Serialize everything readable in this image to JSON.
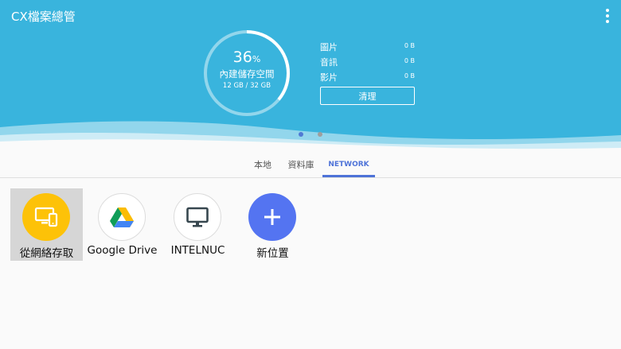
{
  "app": {
    "title": "CX檔案總管"
  },
  "storage": {
    "percent": "36",
    "percent_sign": "%",
    "label": "內建儲存空間",
    "size": "12 GB / 32 GB",
    "used_fraction": 0.36
  },
  "stats": [
    {
      "label": "圖片",
      "value": "0 B"
    },
    {
      "label": "音訊",
      "value": "0 B"
    },
    {
      "label": "影片",
      "value": "0 B"
    }
  ],
  "clean_button": "清理",
  "pager": {
    "pages": 2,
    "active": 1
  },
  "tabs": [
    {
      "label": "本地"
    },
    {
      "label": "資料庫"
    },
    {
      "label": "NETWORK",
      "active": true
    }
  ],
  "items": [
    {
      "label": "從網絡存取",
      "icon": "network-devices-icon",
      "selected": true
    },
    {
      "label": "Google Drive",
      "icon": "google-drive-icon"
    },
    {
      "label": "INTELNUC",
      "icon": "monitor-icon"
    },
    {
      "label": "新位置",
      "icon": "plus-icon"
    }
  ],
  "colors": {
    "header": "#39b4dd",
    "accent": "#4e73d8",
    "network_circle": "#fdc208",
    "add_circle": "#5474f1"
  }
}
